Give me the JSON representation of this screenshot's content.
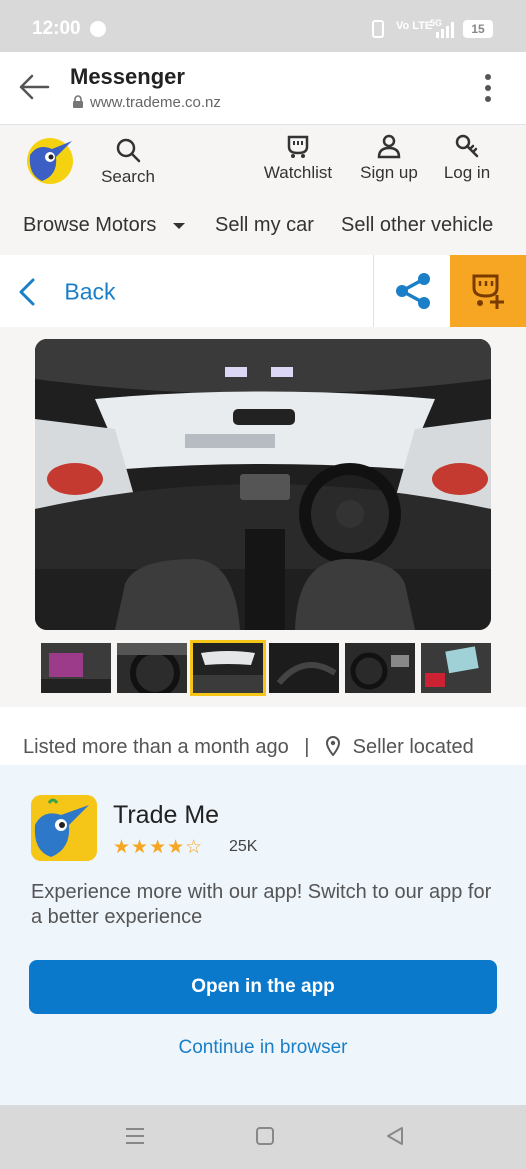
{
  "status_bar": {
    "time": "12:00",
    "network": "Vo LTE",
    "network_gen": "5G",
    "battery": "15"
  },
  "browser": {
    "title": "Messenger",
    "url": "www.trademe.co.nz"
  },
  "site_nav": {
    "search_label": "Search",
    "watchlist_label": "Watchlist",
    "signup_label": "Sign up",
    "login_label": "Log in",
    "browse_motors": "Browse Motors",
    "sell_my_car": "Sell my car",
    "sell_other": "Sell other vehicle"
  },
  "back_bar": {
    "back_label": "Back"
  },
  "listing": {
    "listed_text": "Listed more than a month ago",
    "separator": "|",
    "seller_text": "Seller located"
  },
  "app_promo": {
    "app_name": "Trade Me",
    "stars": "★★★★☆",
    "rating_count": "25K",
    "description": "Experience more with our app! Switch to our app for a better experience",
    "open_button": "Open in the app",
    "continue_link": "Continue in browser"
  },
  "colors": {
    "accent_blue": "#0a79cc",
    "link_blue": "#1a7fc7",
    "watchlist_orange": "#f6a622",
    "star_yellow": "#f5a623"
  }
}
